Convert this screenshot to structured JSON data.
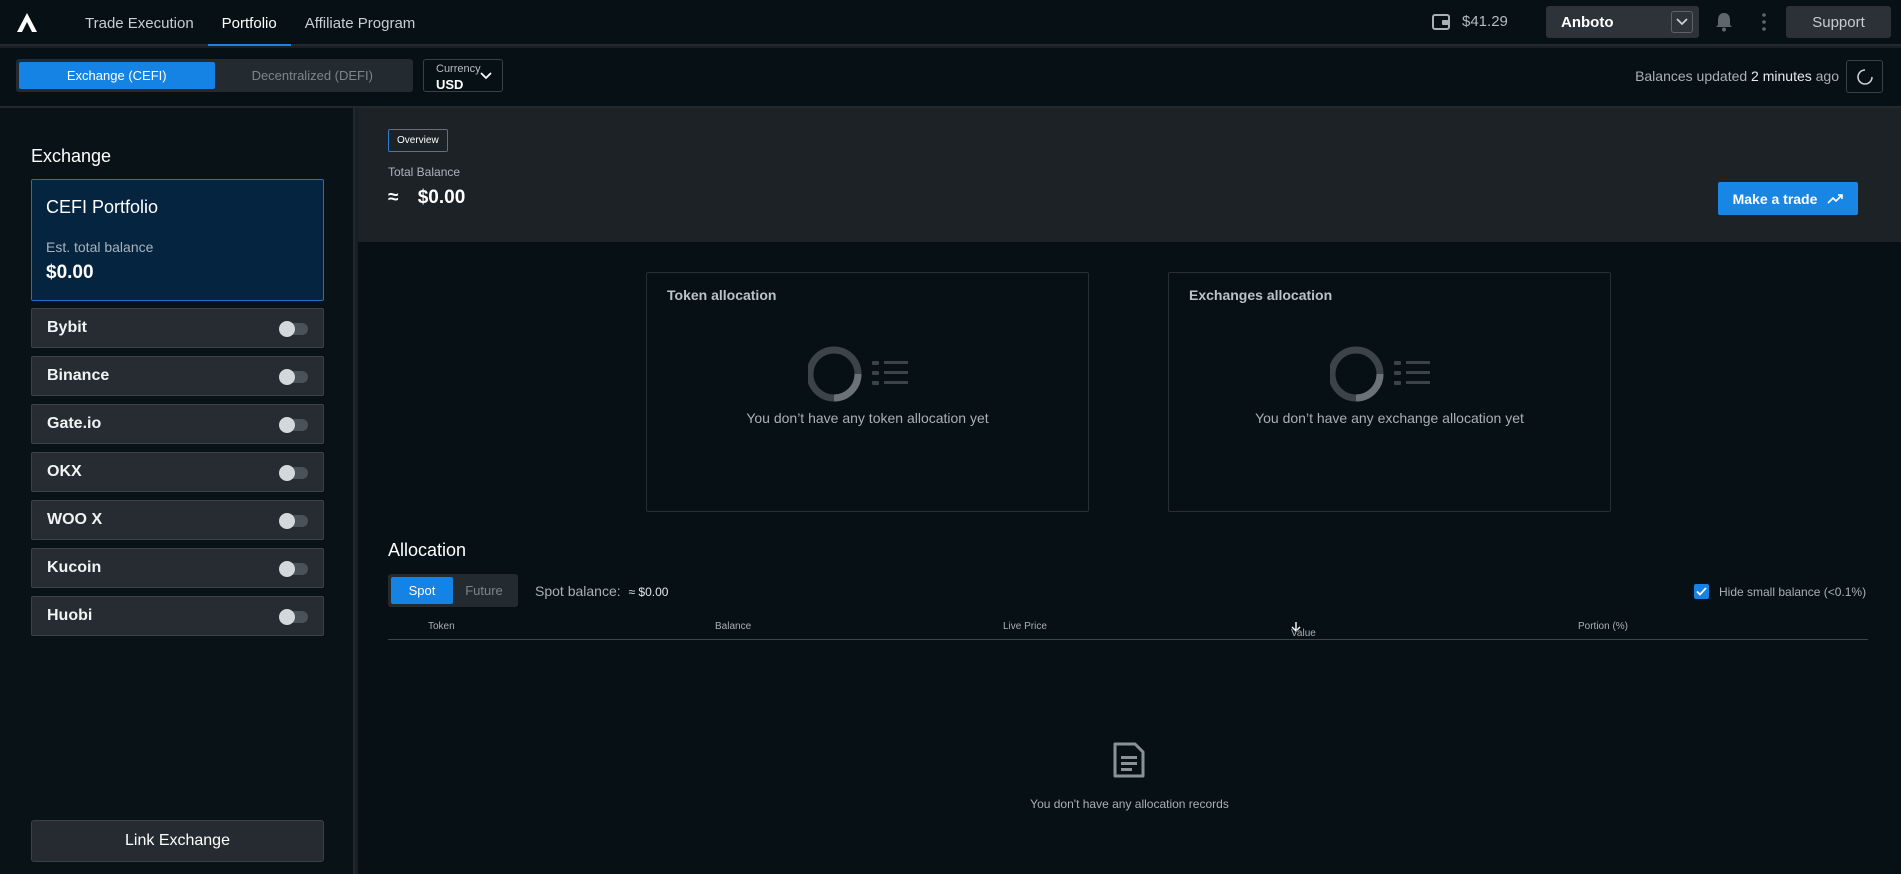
{
  "nav": {
    "items": [
      {
        "label": "Trade Execution"
      },
      {
        "label": "Portfolio"
      },
      {
        "label": "Affiliate Program"
      }
    ],
    "active_index": 1
  },
  "header": {
    "wallet_balance": "$41.29",
    "user_name": "Anboto",
    "support_label": "Support"
  },
  "subbar": {
    "segments": [
      {
        "label": "Exchange (CEFI)"
      },
      {
        "label": "Decentralized (DEFI)"
      }
    ],
    "currency_label": "Currency",
    "currency_value": "USD",
    "updated_prefix": "Balances updated",
    "updated_time": "2 minutes",
    "updated_suffix": "ago"
  },
  "sidebar": {
    "title": "Exchange",
    "portfolio": {
      "title": "CEFI Portfolio",
      "subtitle": "Est. total balance",
      "value": "$0.00"
    },
    "exchanges": [
      {
        "label": "Bybit"
      },
      {
        "label": "Binance"
      },
      {
        "label": "Gate.io"
      },
      {
        "label": "OKX"
      },
      {
        "label": "WOO X"
      },
      {
        "label": "Kucoin"
      },
      {
        "label": "Huobi"
      }
    ],
    "link_button": "Link Exchange"
  },
  "overview": {
    "tag": "Overview",
    "label": "Total Balance",
    "approx": "≈",
    "value": "$0.00",
    "trade_button": "Make a trade"
  },
  "cards": [
    {
      "title": "Token allocation",
      "message": "You don’t have any token allocation yet"
    },
    {
      "title": "Exchanges allocation",
      "message": "You don’t have any exchange allocation yet"
    }
  ],
  "allocation": {
    "title": "Allocation",
    "tabs": [
      {
        "label": "Spot"
      },
      {
        "label": "Future"
      }
    ],
    "spot_label": "Spot balance:",
    "spot_value": "≈ $0.00",
    "hide_small": "Hide small balance (<0.1%)",
    "columns": [
      "Token",
      "Balance",
      "Live Price",
      "Value",
      "Portion (%)"
    ],
    "empty_message": "You don't have any allocation records"
  },
  "colors": {
    "accent": "#1483e3",
    "background": "#061015"
  }
}
